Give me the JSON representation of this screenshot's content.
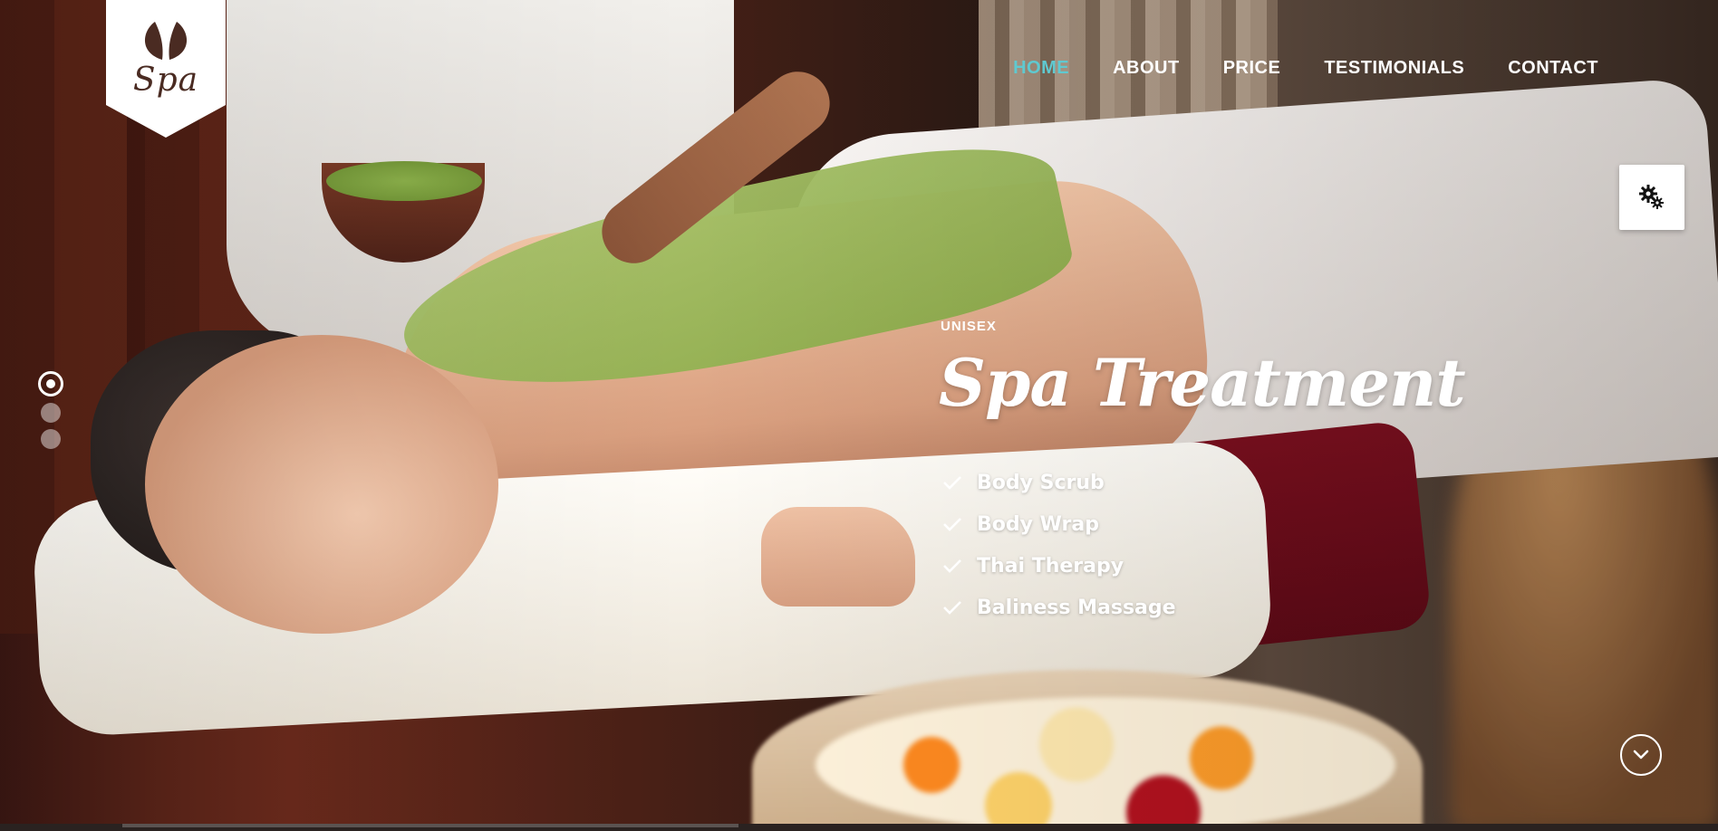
{
  "logo": {
    "text": "Spa",
    "icon": "leaf-icon"
  },
  "nav": {
    "items": [
      {
        "label": "HOME",
        "active": true
      },
      {
        "label": "ABOUT",
        "active": false
      },
      {
        "label": "PRICE",
        "active": false
      },
      {
        "label": "TESTIMONIALS",
        "active": false
      },
      {
        "label": "CONTACT",
        "active": false
      }
    ]
  },
  "settings": {
    "icon": "gears-icon"
  },
  "slider": {
    "dots": 3,
    "active_index": 0
  },
  "hero": {
    "eyebrow": "UNISEX",
    "title": "Spa Treatment",
    "features": [
      {
        "label": "Body Scrub",
        "icon": "check-icon"
      },
      {
        "label": "Body Wrap",
        "icon": "check-icon"
      },
      {
        "label": "Thai Therapy",
        "icon": "check-icon"
      },
      {
        "label": "Baliness Massage",
        "icon": "check-icon"
      }
    ]
  },
  "scroll": {
    "icon": "chevron-down-icon"
  },
  "colors": {
    "accent": "#5fc9d0",
    "text": "#ffffff",
    "logo_brown": "#4a2b22"
  }
}
